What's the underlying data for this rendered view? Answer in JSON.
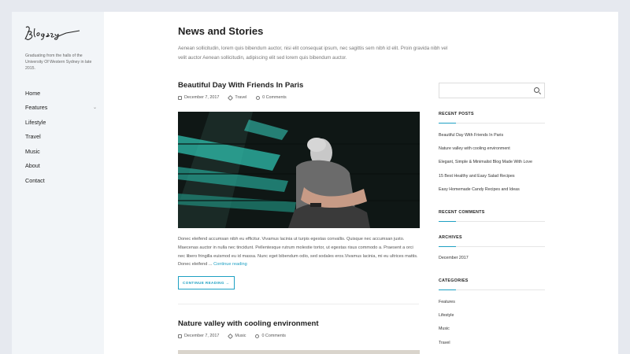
{
  "site": {
    "logo_text": "Blogezy",
    "tagline": "Graduating from the halls of the University Of Western Sydney in late 2015."
  },
  "nav": {
    "items": [
      {
        "label": "Home"
      },
      {
        "label": "Features",
        "has_submenu": true
      },
      {
        "label": "Lifestyle"
      },
      {
        "label": "Travel"
      },
      {
        "label": "Music"
      },
      {
        "label": "About"
      },
      {
        "label": "Contact"
      }
    ]
  },
  "page": {
    "title": "News and Stories",
    "intro": "Aenean sollicitudin, lorem quis bibendum auctor, nisi elit consequat ipsum, nec sagittis sem nibh id elit. Proin gravida nibh vel velit auctor Aenean sollicitudin, adipiscing elit sed lorem quis bibendum auctor."
  },
  "posts": [
    {
      "title": "Beautiful Day With Friends In Paris",
      "date": "December 7, 2017",
      "category": "Travel",
      "comments": "0 Comments",
      "excerpt": "Donec eleifend accumsan nibh eu efficitur. Vivamus lacinia ut turpis egestas convallis. Quisque nec accumsan justo. Maecenas auctor in nulla nec tincidunt. Pellentesque rutrum molestie tortor, ut egestas risus commodo a. Praesent a orci nec libero fringilla euismod eu id massa. Nunc eget bibendum odio, sed sodales eros.Vivamus lacinia, mi eu ultrices mattis. Donec eleifend ...",
      "continue_link": "Continue reading",
      "button": "CONTINUE READING →"
    },
    {
      "title": "Nature valley with cooling environment",
      "date": "December 7, 2017",
      "category": "Music",
      "comments": "0 Comments"
    }
  ],
  "sidebar_widgets": {
    "search_placeholder": "",
    "recent_posts": {
      "title": "RECENT POSTS",
      "items": [
        "Beautiful Day With Friends In Paris",
        "Nature valley with cooling environment",
        "Elegant, Simple & Minimalist Blog Made With Love",
        "15 Best Healthy and Easy Salad Recipes",
        "Easy Homemade Candy Recipes and Ideas"
      ]
    },
    "recent_comments": {
      "title": "RECENT COMMENTS"
    },
    "archives": {
      "title": "ARCHIVES",
      "items": [
        "December 2017"
      ]
    },
    "categories": {
      "title": "CATEGORIES",
      "items": [
        "Features",
        "Lifestyle",
        "Music",
        "Travel"
      ]
    }
  },
  "colors": {
    "accent": "#1ea0c3",
    "sidebar_bg": "#f2f5f8",
    "page_bg": "#e6e9ef"
  }
}
